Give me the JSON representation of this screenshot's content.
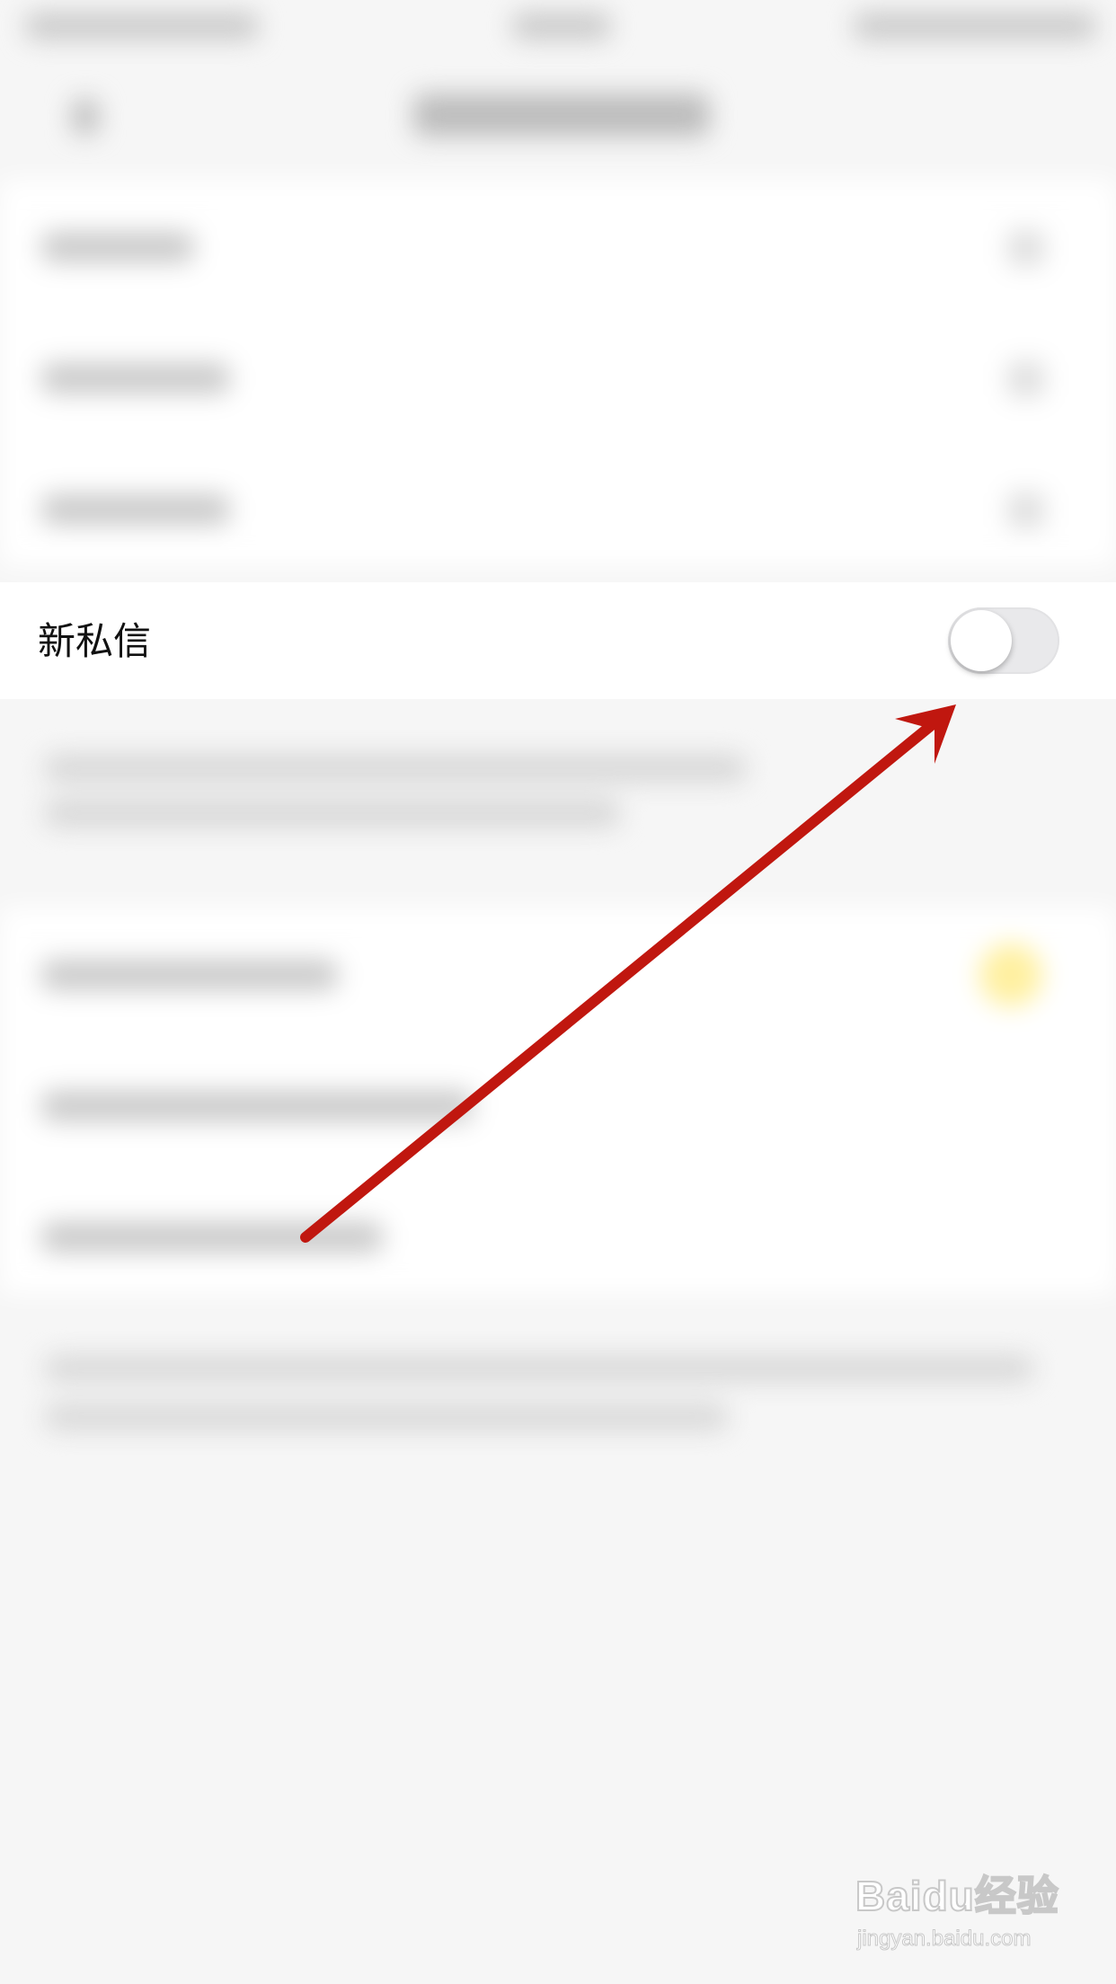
{
  "settings": {
    "new_message_label": "新私信",
    "new_message_toggle_on": false
  },
  "annotation": {
    "arrow_color": "#c0170f"
  },
  "watermark": {
    "logo_text": "Baidu经验",
    "url": "jingyan.baidu.com"
  },
  "colors": {
    "background": "#f6f6f6",
    "row_background": "#ffffff",
    "toggle_off": "#e9e9eb"
  }
}
